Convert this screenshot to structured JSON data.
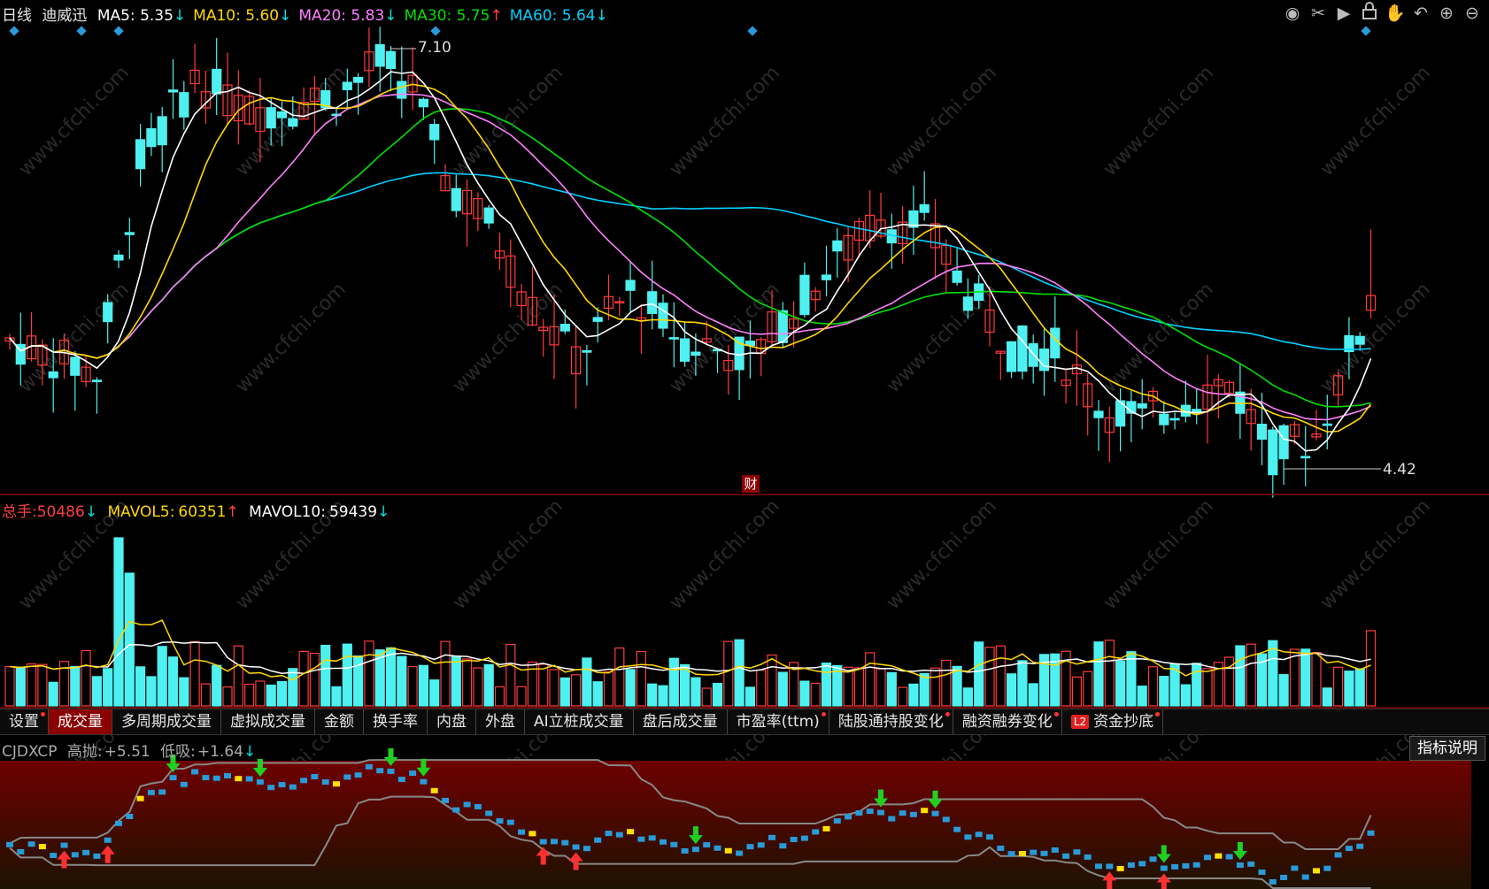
{
  "header": {
    "period": "日线",
    "stock": "迪威迅",
    "ma": [
      {
        "label": "MA5:",
        "value": "5.35",
        "arrow": "↓",
        "color": "#ffffff",
        "arrowColor": "#00e0e0"
      },
      {
        "label": "MA10:",
        "value": "5.60",
        "arrow": "↓",
        "color": "#ffd700",
        "arrowColor": "#00e0e0"
      },
      {
        "label": "MA20:",
        "value": "5.83",
        "arrow": "↓",
        "color": "#ff80ff",
        "arrowColor": "#00e0e0"
      },
      {
        "label": "MA30:",
        "value": "5.75",
        "arrow": "↑",
        "color": "#00e000",
        "arrowColor": "#ff4040"
      },
      {
        "label": "MA60:",
        "value": "5.64",
        "arrow": "↓",
        "color": "#00d0ff",
        "arrowColor": "#00e0e0"
      }
    ]
  },
  "toolbar_icons": [
    "eye-icon",
    "scissors-icon",
    "play-icon",
    "lock-icon",
    "hand-icon",
    "undo-icon",
    "zoom-in-icon",
    "zoom-out-icon"
  ],
  "price_chart": {
    "high_label": "7.10",
    "low_label": "4.42",
    "fin_marker": "财",
    "colors": {
      "up": "#ff3b3b",
      "down": "#4ff0f0",
      "ma5": "#ffffff",
      "ma10": "#ffd700",
      "ma20": "#ff80ff",
      "ma30": "#00e000",
      "ma60": "#00d0ff"
    }
  },
  "volume": {
    "total_label": "总手:",
    "total_value": "50486",
    "total_arrow": "↓",
    "mavol5_label": "MAVOL5:",
    "mavol5_value": "60351",
    "mavol5_arrow": "↑",
    "mavol10_label": "MAVOL10:",
    "mavol10_value": "59439",
    "mavol10_arrow": "↓"
  },
  "tabs": [
    {
      "label": "设置",
      "dot": true,
      "active": false
    },
    {
      "label": "成交量",
      "dot": false,
      "active": true
    },
    {
      "label": "多周期成交量",
      "dot": false,
      "active": false
    },
    {
      "label": "虚拟成交量",
      "dot": false,
      "active": false
    },
    {
      "label": "金额",
      "dot": false,
      "active": false
    },
    {
      "label": "换手率",
      "dot": false,
      "active": false
    },
    {
      "label": "内盘",
      "dot": false,
      "active": false
    },
    {
      "label": "外盘",
      "dot": false,
      "active": false
    },
    {
      "label": "AI立桩成交量",
      "dot": false,
      "active": false
    },
    {
      "label": "盘后成交量",
      "dot": false,
      "active": false
    },
    {
      "label": "市盈率(ttm)",
      "dot": true,
      "active": false
    },
    {
      "label": "陆股通持股变化",
      "dot": true,
      "active": false
    },
    {
      "label": "融资融券变化",
      "dot": true,
      "active": false
    },
    {
      "label": "资金抄底",
      "dot": true,
      "active": false,
      "badge": "L2"
    }
  ],
  "indicator": {
    "name": "CJDXCP",
    "high_label": "高抛:",
    "high_value": "+5.51",
    "low_label": "低吸:",
    "low_value": "+1.64",
    "low_arrow": "↓",
    "help_button": "指标说明"
  },
  "watermark": "www.cfchi.com"
}
